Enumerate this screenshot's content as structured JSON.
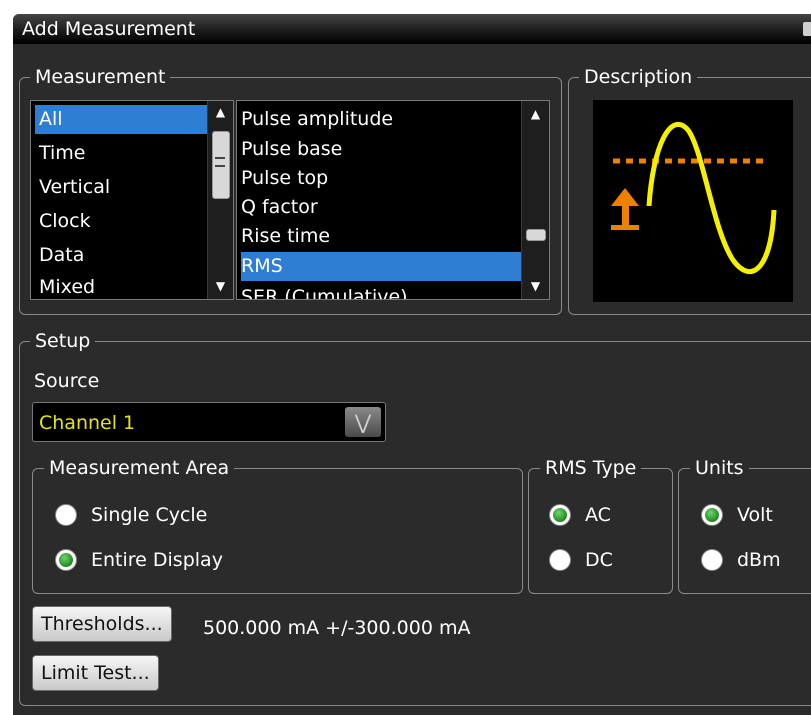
{
  "dialog": {
    "title": "Add Measurement"
  },
  "measurement": {
    "legend": "Measurement",
    "categories": [
      {
        "label": "All",
        "selected": true
      },
      {
        "label": "Time"
      },
      {
        "label": "Vertical"
      },
      {
        "label": "Clock"
      },
      {
        "label": "Data"
      },
      {
        "label": "Mixed"
      }
    ],
    "items": [
      {
        "label": "Pulse amplitude"
      },
      {
        "label": "Pulse base"
      },
      {
        "label": "Pulse top"
      },
      {
        "label": "Q factor"
      },
      {
        "label": "Rise time"
      },
      {
        "label": "RMS",
        "selected": true
      },
      {
        "label": "SER (Cumulative)"
      }
    ]
  },
  "description": {
    "legend": "Description",
    "colors": {
      "wave": "#f5f000",
      "threshold": "#f08000"
    }
  },
  "setup": {
    "legend": "Setup",
    "source_label": "Source",
    "source_value": "Channel 1",
    "measurement_area": {
      "legend": "Measurement Area",
      "options": [
        {
          "label": "Single Cycle",
          "checked": false
        },
        {
          "label": "Entire Display",
          "checked": true
        }
      ]
    },
    "rms_type": {
      "legend": "RMS Type",
      "options": [
        {
          "label": "AC",
          "checked": true
        },
        {
          "label": "DC",
          "checked": false
        }
      ]
    },
    "units": {
      "legend": "Units",
      "options": [
        {
          "label": "Volt",
          "checked": true
        },
        {
          "label": "dBm",
          "checked": false
        }
      ]
    },
    "thresholds_button": "Thresholds...",
    "thresholds_value": "500.000 mA +/-300.000 mA",
    "limit_test_button": "Limit Test..."
  },
  "colors": {
    "accent": "#2e7fd4",
    "source_text": "#e6e600",
    "panel": "#2b2b2b"
  }
}
